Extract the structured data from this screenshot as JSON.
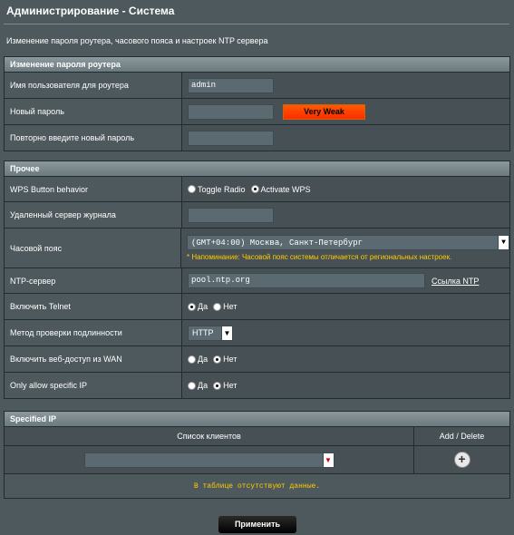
{
  "header": {
    "title": "Администрирование - Система",
    "description": "Изменение пароля роутера, часового пояса и настроек NTP сервера"
  },
  "password_section": {
    "title": "Изменение пароля роутера",
    "username_label": "Имя пользователя для роутера",
    "username_value": "admin",
    "new_password_label": "Новый пароль",
    "new_password_value": "",
    "strength": "Very Weak",
    "repeat_label": "Повторно введите новый пароль",
    "repeat_value": ""
  },
  "misc_section": {
    "title": "Прочее",
    "wps": {
      "label": "WPS Button behavior",
      "options": [
        "Toggle Radio",
        "Activate WPS"
      ],
      "selected": "Activate WPS"
    },
    "log_server": {
      "label": "Удаленный сервер журнала",
      "value": ""
    },
    "timezone": {
      "label": "Часовой пояс",
      "value": "(GMT+04:00) Москва, Санкт-Петербург",
      "hint": "* Напоминание: Часовой пояс системы отличается от региональных настроек."
    },
    "ntp": {
      "label": "NTP-сервер",
      "value": "pool.ntp.org",
      "link": "Ссылка NTP"
    },
    "telnet": {
      "label": "Включить Telnet",
      "yes": "Да",
      "no": "Нет",
      "selected": "Да"
    },
    "auth": {
      "label": "Метод проверки подлинности",
      "value": "HTTP"
    },
    "wan_access": {
      "label": "Включить веб-доступ из WAN",
      "yes": "Да",
      "no": "Нет",
      "selected": "Нет"
    },
    "specific_ip": {
      "label": "Only allow specific IP",
      "yes": "Да",
      "no": "Нет",
      "selected": "Нет"
    }
  },
  "specified_ip": {
    "title": "Specified IP",
    "col_clients": "Список клиентов",
    "col_add_delete": "Add / Delete",
    "client_value": "",
    "empty_message": "В таблице отсутствуют данные."
  },
  "apply_label": "Применить",
  "colors": {
    "background": "#4d595d",
    "strength_weak": "#ff3300",
    "hint": "#ffcc00"
  }
}
